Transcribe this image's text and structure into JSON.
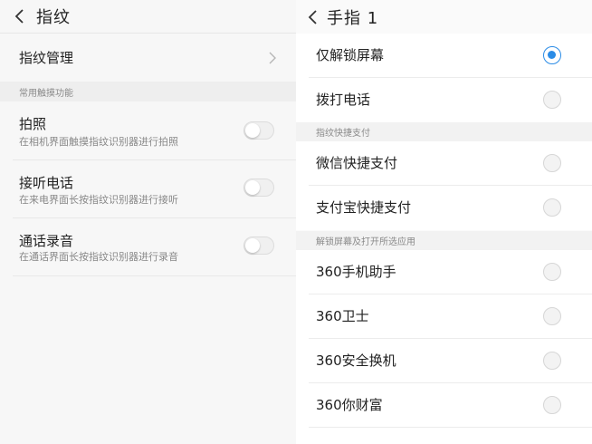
{
  "left": {
    "title": "指纹",
    "manage_label": "指纹管理",
    "section_label": "常用触摸功能",
    "options": [
      {
        "title": "拍照",
        "subtitle": "在相机界面触摸指纹识别器进行拍照",
        "enabled": false
      },
      {
        "title": "接听电话",
        "subtitle": "在来电界面长按指纹识别器进行接听",
        "enabled": false
      },
      {
        "title": "通话录音",
        "subtitle": "在通话界面长按指纹识别器进行录音",
        "enabled": false
      }
    ]
  },
  "right": {
    "title": "手指 1",
    "items_top": [
      {
        "label": "仅解锁屏幕",
        "selected": true
      },
      {
        "label": "拨打电话",
        "selected": false
      }
    ],
    "section_pay": "指纹快捷支付",
    "items_pay": [
      {
        "label": "微信快捷支付",
        "selected": false
      },
      {
        "label": "支付宝快捷支付",
        "selected": false
      }
    ],
    "section_apps": "解锁屏幕及打开所选应用",
    "items_apps": [
      {
        "label": "360手机助手",
        "selected": false
      },
      {
        "label": "360卫士",
        "selected": false
      },
      {
        "label": "360安全换机",
        "selected": false
      },
      {
        "label": "360你财富",
        "selected": false
      }
    ]
  },
  "colors": {
    "accent": "#2b8ce6",
    "section_bg": "#eeeeee",
    "subtitle_text": "#888888"
  }
}
